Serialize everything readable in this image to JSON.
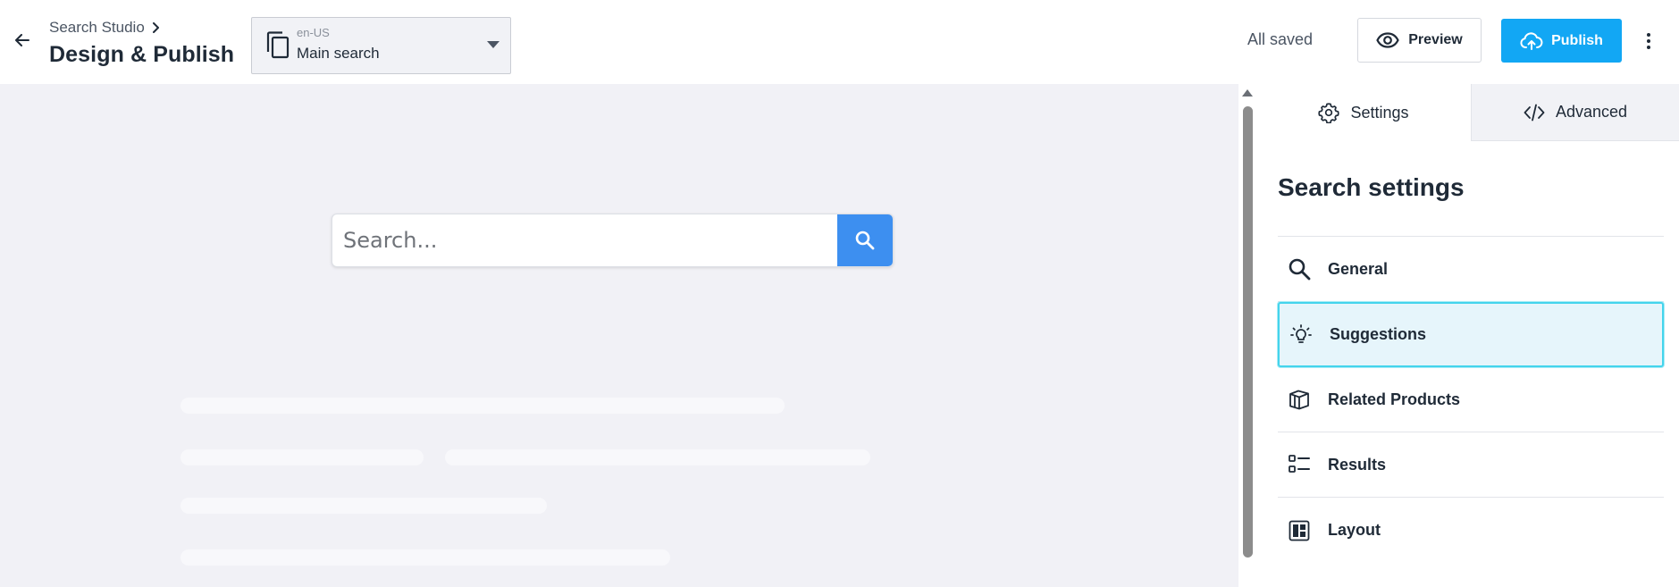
{
  "header": {
    "breadcrumb": "Search Studio",
    "title": "Design & Publish",
    "selector": {
      "locale": "en-US",
      "value": "Main search"
    },
    "save_status": "All saved",
    "preview_label": "Preview",
    "publish_label": "Publish"
  },
  "canvas": {
    "search_placeholder": "Search..."
  },
  "panel": {
    "tabs": [
      {
        "label": "Settings",
        "icon": "gear-icon",
        "active": true
      },
      {
        "label": "Advanced",
        "icon": "code-icon",
        "active": false
      }
    ],
    "title": "Search settings",
    "items": [
      {
        "label": "General",
        "icon": "search-icon",
        "active": false
      },
      {
        "label": "Suggestions",
        "icon": "lightbulb-icon",
        "active": true
      },
      {
        "label": "Related Products",
        "icon": "box-icon",
        "active": false
      },
      {
        "label": "Results",
        "icon": "list-icon",
        "active": false
      },
      {
        "label": "Layout",
        "icon": "layout-icon",
        "active": false
      }
    ]
  },
  "colors": {
    "accent": "#12a7f4",
    "search_button": "#3d8ff0",
    "active_item_bg": "#e6f5fb",
    "active_item_border": "#44d4ec",
    "canvas_bg": "#f1f1f6",
    "text": "#1f2a37"
  }
}
